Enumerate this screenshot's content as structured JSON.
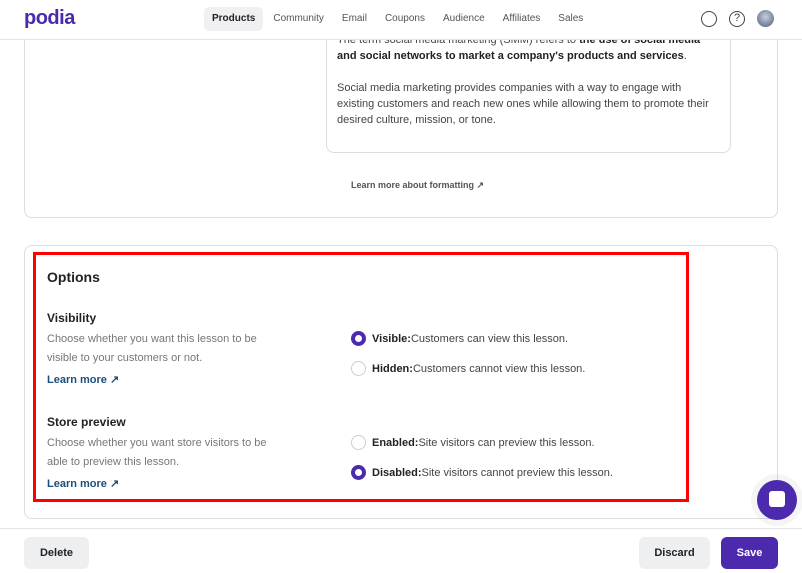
{
  "nav": {
    "logo": "podia",
    "items": [
      "Products",
      "Community",
      "Email",
      "Coupons",
      "Audience",
      "Affiliates",
      "Sales"
    ],
    "active": "Products"
  },
  "editor": {
    "p1_normal": "The term social media marketing (SMM) refers to ",
    "p1_bold": "the use of social media and social networks to market a company's products and services",
    "p1_end": ".",
    "p2": "Social media marketing provides companies with a way to engage with existing customers and reach new ones while allowing them to promote their desired culture, mission, or tone.",
    "formatting_link": "Learn more about formatting ↗"
  },
  "options": {
    "title": "Options",
    "visibility": {
      "title": "Visibility",
      "desc": "Choose whether you want this lesson to be visible to your customers or not.",
      "learn_more": "Learn more ↗",
      "choices": [
        {
          "label": "Visible:",
          "text": " Customers can view this lesson.",
          "selected": true
        },
        {
          "label": "Hidden:",
          "text": " Customers cannot view this lesson.",
          "selected": false
        }
      ]
    },
    "store_preview": {
      "title": "Store preview",
      "desc": "Choose whether you want store visitors to be able to preview this lesson.",
      "learn_more": "Learn more ↗",
      "choices": [
        {
          "label": "Enabled:",
          "text": " Site visitors can preview this lesson.",
          "selected": false
        },
        {
          "label": "Disabled:",
          "text": " Site visitors cannot preview this lesson.",
          "selected": true
        }
      ]
    }
  },
  "footer": {
    "delete": "Delete",
    "discard": "Discard",
    "save": "Save"
  },
  "colors": {
    "brand": "#4b2aad",
    "highlight": "#ff0000"
  }
}
